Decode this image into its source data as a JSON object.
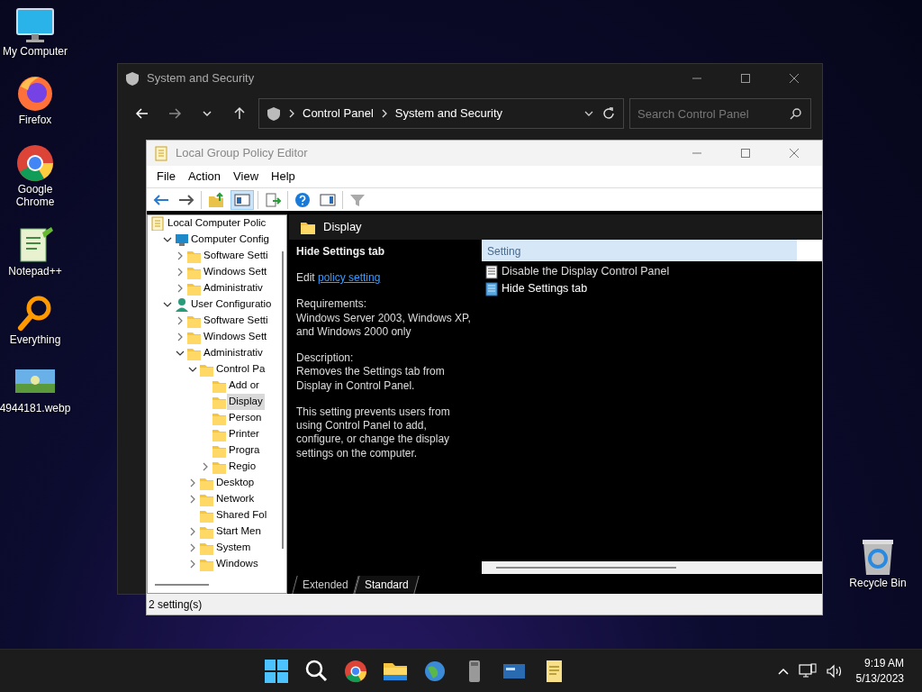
{
  "desktop_icons": [
    {
      "label": "My Computer",
      "kind": "monitor"
    },
    {
      "label": "Firefox",
      "kind": "firefox"
    },
    {
      "label": "Google Chrome",
      "kind": "chrome"
    },
    {
      "label": "Notepad++",
      "kind": "notepad"
    },
    {
      "label": "Everything",
      "kind": "search"
    },
    {
      "label": "4944181.webp",
      "kind": "image"
    }
  ],
  "recycle_bin": {
    "label": "Recycle Bin"
  },
  "explorer": {
    "title": "System and Security",
    "breadcrumb": [
      "Control Panel",
      "System and Security"
    ],
    "search": {
      "placeholder": "Search Control Panel"
    }
  },
  "gpedit": {
    "title": "Local Group Policy Editor",
    "menu": [
      "File",
      "Action",
      "View",
      "Help"
    ],
    "tree": [
      {
        "label": "Local Computer Polic",
        "kind": "policy",
        "selected": false,
        "children": [
          {
            "label": "Computer Config",
            "kind": "computer",
            "selected": false,
            "expanded": true,
            "children": [
              {
                "label": "Software Setti",
                "kind": "folder",
                "selected": false,
                "expanded": false
              },
              {
                "label": "Windows Sett",
                "kind": "folder",
                "selected": false,
                "expanded": false
              },
              {
                "label": "Administrativ",
                "kind": "folder",
                "selected": false,
                "expanded": false
              }
            ]
          },
          {
            "label": "User Configuratio",
            "kind": "user",
            "selected": false,
            "expanded": true,
            "children": [
              {
                "label": "Software Setti",
                "kind": "folder",
                "selected": false,
                "expanded": false
              },
              {
                "label": "Windows Sett",
                "kind": "folder",
                "selected": false,
                "expanded": false
              },
              {
                "label": "Administrativ",
                "kind": "folder",
                "selected": false,
                "expanded": true,
                "children": [
                  {
                    "label": "Control Pa",
                    "kind": "folder",
                    "selected": false,
                    "expanded": true,
                    "children": [
                      {
                        "label": "Add or",
                        "kind": "folder",
                        "selected": false
                      },
                      {
                        "label": "Display",
                        "kind": "folder",
                        "selected": true
                      },
                      {
                        "label": "Person",
                        "kind": "folder",
                        "selected": false
                      },
                      {
                        "label": "Printer",
                        "kind": "folder",
                        "selected": false
                      },
                      {
                        "label": "Progra",
                        "kind": "folder",
                        "selected": false
                      },
                      {
                        "label": "Regio",
                        "kind": "folder",
                        "selected": false,
                        "expanded": false
                      }
                    ]
                  },
                  {
                    "label": "Desktop",
                    "kind": "folder",
                    "selected": false,
                    "expanded": false
                  },
                  {
                    "label": "Network",
                    "kind": "folder",
                    "selected": false,
                    "expanded": false
                  },
                  {
                    "label": "Shared Fol",
                    "kind": "folder",
                    "selected": false
                  },
                  {
                    "label": "Start Men",
                    "kind": "folder",
                    "selected": false,
                    "expanded": false
                  },
                  {
                    "label": "System",
                    "kind": "folder",
                    "selected": false,
                    "expanded": false
                  },
                  {
                    "label": "Windows",
                    "kind": "folder",
                    "selected": false,
                    "expanded": false
                  }
                ]
              }
            ]
          }
        ]
      }
    ],
    "folder_header": "Display",
    "detail": {
      "title": "Hide Settings tab",
      "edit_prefix": "Edit",
      "edit_link": "policy setting",
      "paragraphs": [
        "Requirements:\nWindows Server 2003, Windows XP, and Windows 2000 only",
        "Description:\nRemoves the Settings tab from Display in Control Panel.",
        "This setting prevents users from using Control Panel to add, configure, or change the display settings on the computer."
      ]
    },
    "list": {
      "column": "Setting",
      "items": [
        {
          "label": "Disable the Display Control Panel",
          "kind": "plain"
        },
        {
          "label": "Hide Settings tab",
          "kind": "blue"
        }
      ]
    },
    "view_tabs": [
      {
        "label": "Extended",
        "selected": false
      },
      {
        "label": "Standard",
        "selected": true
      }
    ],
    "status_bar": "2 setting(s)"
  },
  "taskbar": {
    "apps": [
      {
        "kind": "start"
      },
      {
        "kind": "search"
      },
      {
        "kind": "chrome"
      },
      {
        "kind": "explorer"
      },
      {
        "kind": "globe"
      },
      {
        "kind": "drive"
      },
      {
        "kind": "card"
      },
      {
        "kind": "notepad"
      }
    ],
    "time": "9:19 AM",
    "date": "5/13/2023"
  }
}
